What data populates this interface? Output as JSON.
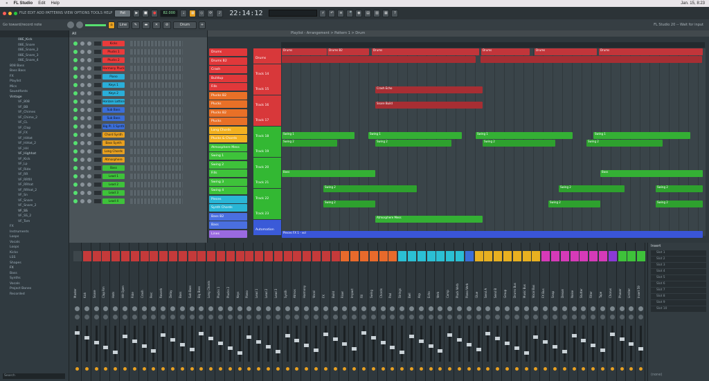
{
  "menubar": {
    "app": "FL Studio",
    "items": [
      "Edit",
      "Help"
    ],
    "datetime": "Jan. 15, 8:23"
  },
  "toolbar": {
    "menu": "FILE EDIT ADD PATTERNS VIEW OPTIONS TOOLS HELP",
    "pattern_btn": "Pat",
    "tempo": "82.000",
    "time": "22:14:12",
    "hint": "Go toward/record note"
  },
  "toolbar2": {
    "snap": "Line",
    "pattern": "Drum",
    "status": "FL Studio 20 -- Wait for input"
  },
  "browser": {
    "items": [
      "08E_Kick",
      "08E_Snare",
      "08E_Snare_2",
      "08E_Snare_3",
      "08E_Snare_4",
      "808 Bass",
      "Bass Bass",
      "FX",
      "Playlist",
      "Mics",
      "Soundfonts",
      "Vintage",
      "VF_808",
      "VF_BB",
      "VF_Chimes",
      "VF_Chime_2",
      "VF_CL",
      "VF_Clap",
      "VF_FX",
      "VF_HiHat",
      "VF_HiHat_2",
      "VF_HH",
      "VF_Highhat",
      "VF_Kick",
      "VF_Lp",
      "VF_Ride",
      "VF_RR",
      "VF_RRfill",
      "VF_RRhat",
      "VF_RRhat_2",
      "VF_Sn",
      "VF_Snare",
      "VF_Snare_2",
      "VF_SS",
      "VF_SS_2",
      "VF_Tom",
      "FX",
      "Instruments",
      "Loops",
      "Vocals",
      "Loops",
      "Kicks",
      "LSS",
      "Shapes",
      "FX",
      "Bass",
      "Synths",
      "Vocals",
      "Project Bones",
      "Recorded"
    ],
    "search": "Search"
  },
  "channel_rack": {
    "header": "All",
    "channels": [
      {
        "name": "Kicks",
        "color": "#ea3b3b"
      },
      {
        "name": "Plucks 1",
        "color": "#ea3b3b"
      },
      {
        "name": "Plucks 2",
        "color": "#ea3b3b"
      },
      {
        "name": "Harmony Pluck",
        "color": "#ea3b3b"
      },
      {
        "name": "Piano",
        "color": "#2aaed8"
      },
      {
        "name": "Keys 1",
        "color": "#2aaed8"
      },
      {
        "name": "Keys 2",
        "color": "#2aaed8"
      },
      {
        "name": "Horizon Lattice",
        "color": "#2aaed8"
      },
      {
        "name": "Sub Bass",
        "color": "#3b6ed8"
      },
      {
        "name": "Sub Bass",
        "color": "#3b6ed8"
      },
      {
        "name": "Big Pl. 1 Synth",
        "color": "#3b6ed8"
      },
      {
        "name": "Chord Synth",
        "color": "#e8a020"
      },
      {
        "name": "Bass Synth",
        "color": "#e8a020"
      },
      {
        "name": "Long Chords",
        "color": "#e8a020"
      },
      {
        "name": "Atmosphere",
        "color": "#e8a020"
      },
      {
        "name": "Bass",
        "color": "#3ec23a"
      },
      {
        "name": "Lead 1",
        "color": "#3ec23a"
      },
      {
        "name": "Lead 2",
        "color": "#3ec23a"
      },
      {
        "name": "Lead 3",
        "color": "#3ec23a"
      },
      {
        "name": "Lead 4",
        "color": "#3ec23a"
      }
    ]
  },
  "playlist": {
    "title": "Playlist - Arrangement > Pattern 1 > Drum",
    "tracks": [
      {
        "name": "Drums",
        "color": "#e0383a"
      },
      {
        "name": "Drums B2",
        "color": "#e0383a"
      },
      {
        "name": "Crash",
        "color": "#e0383a"
      },
      {
        "name": "Buildup",
        "color": "#e0383a"
      },
      {
        "name": "Fills",
        "color": "#e0383a"
      },
      {
        "name": "Plucks B2",
        "color": "#e87027"
      },
      {
        "name": "Plucks",
        "color": "#e87027"
      },
      {
        "name": "Plucks B2",
        "color": "#e87027"
      },
      {
        "name": "Plucks",
        "color": "#e87027"
      },
      {
        "name": "Long Chords",
        "color": "#f2b020"
      },
      {
        "name": "Plucks & Chords",
        "color": "#f2b020"
      },
      {
        "name": "Atmosphere Mess",
        "color": "#3ec23a"
      },
      {
        "name": "Swing 1",
        "color": "#3ec23a"
      },
      {
        "name": "Swing 2",
        "color": "#3ec23a"
      },
      {
        "name": "Fills",
        "color": "#3ec23a"
      },
      {
        "name": "Swing 3",
        "color": "#3ec23a"
      },
      {
        "name": "Swing 4",
        "color": "#3ec23a"
      },
      {
        "name": "Pieces",
        "color": "#2ab6d6"
      },
      {
        "name": "Synth Chords",
        "color": "#2ab6d6"
      },
      {
        "name": "Bass B2",
        "color": "#4a6fe0"
      },
      {
        "name": "Bass",
        "color": "#4a6fe0"
      },
      {
        "name": "Lines",
        "color": "#9a6ae0"
      }
    ],
    "track_headers": [
      "Drums",
      "Track 14",
      "Track 15",
      "Track 16",
      "Track 17",
      "Track 18",
      "Track 19",
      "Track 20",
      "Track 21",
      "Track 22",
      "Track 23",
      "Automation"
    ],
    "clip_labels": [
      "Drums",
      "Drums B2",
      "Drums",
      "Swing 1",
      "Swing 2",
      "Lead Guitar",
      "Bass",
      "Atmosphere Mess",
      "Pieces FX 1 - vol",
      "Crash Echo",
      "Snare Build"
    ]
  },
  "mixer": {
    "channels": [
      "Master",
      "Kick",
      "Snare",
      "Clap Rm",
      "Hats",
      "HH Open",
      "Ride",
      "Crash",
      "Perc",
      "Reverb",
      "Delay",
      "Bass",
      "Sub Bass",
      "Big Bass",
      "Long Chords",
      "Plucks 1",
      "Plucks 2",
      "Keys",
      "Piano",
      "Lead 1",
      "Lead 2",
      "Lead 3",
      "Synth",
      "Atmos",
      "Harmony",
      "Vocal",
      "FX",
      "Build",
      "Riser",
      "Impact",
      "Fill",
      "Swing",
      "Chords",
      "Pad",
      "Strings",
      "Bell",
      "Arp",
      "Echo",
      "Verb",
      "Comp",
      "Pluck Verb",
      "Piano Verb",
      "Glue",
      "Send A",
      "Send B",
      "Group",
      "Drums Bus",
      "Music Bus",
      "Vocal Bus",
      "FX Bus",
      "Snap",
      "Dream",
      "Noise",
      "Stutter",
      "Filter",
      "Tape",
      "Chorus",
      "Phaser",
      "Limiter",
      "Insert 59"
    ],
    "right_panel_title": "Insert",
    "slots": [
      "Slot 1",
      "Slot 2",
      "Slot 3",
      "Slot 4",
      "Slot 5",
      "Slot 6",
      "Slot 7",
      "Slot 8",
      "Slot 9",
      "Slot 10"
    ],
    "footer": "(none)"
  }
}
